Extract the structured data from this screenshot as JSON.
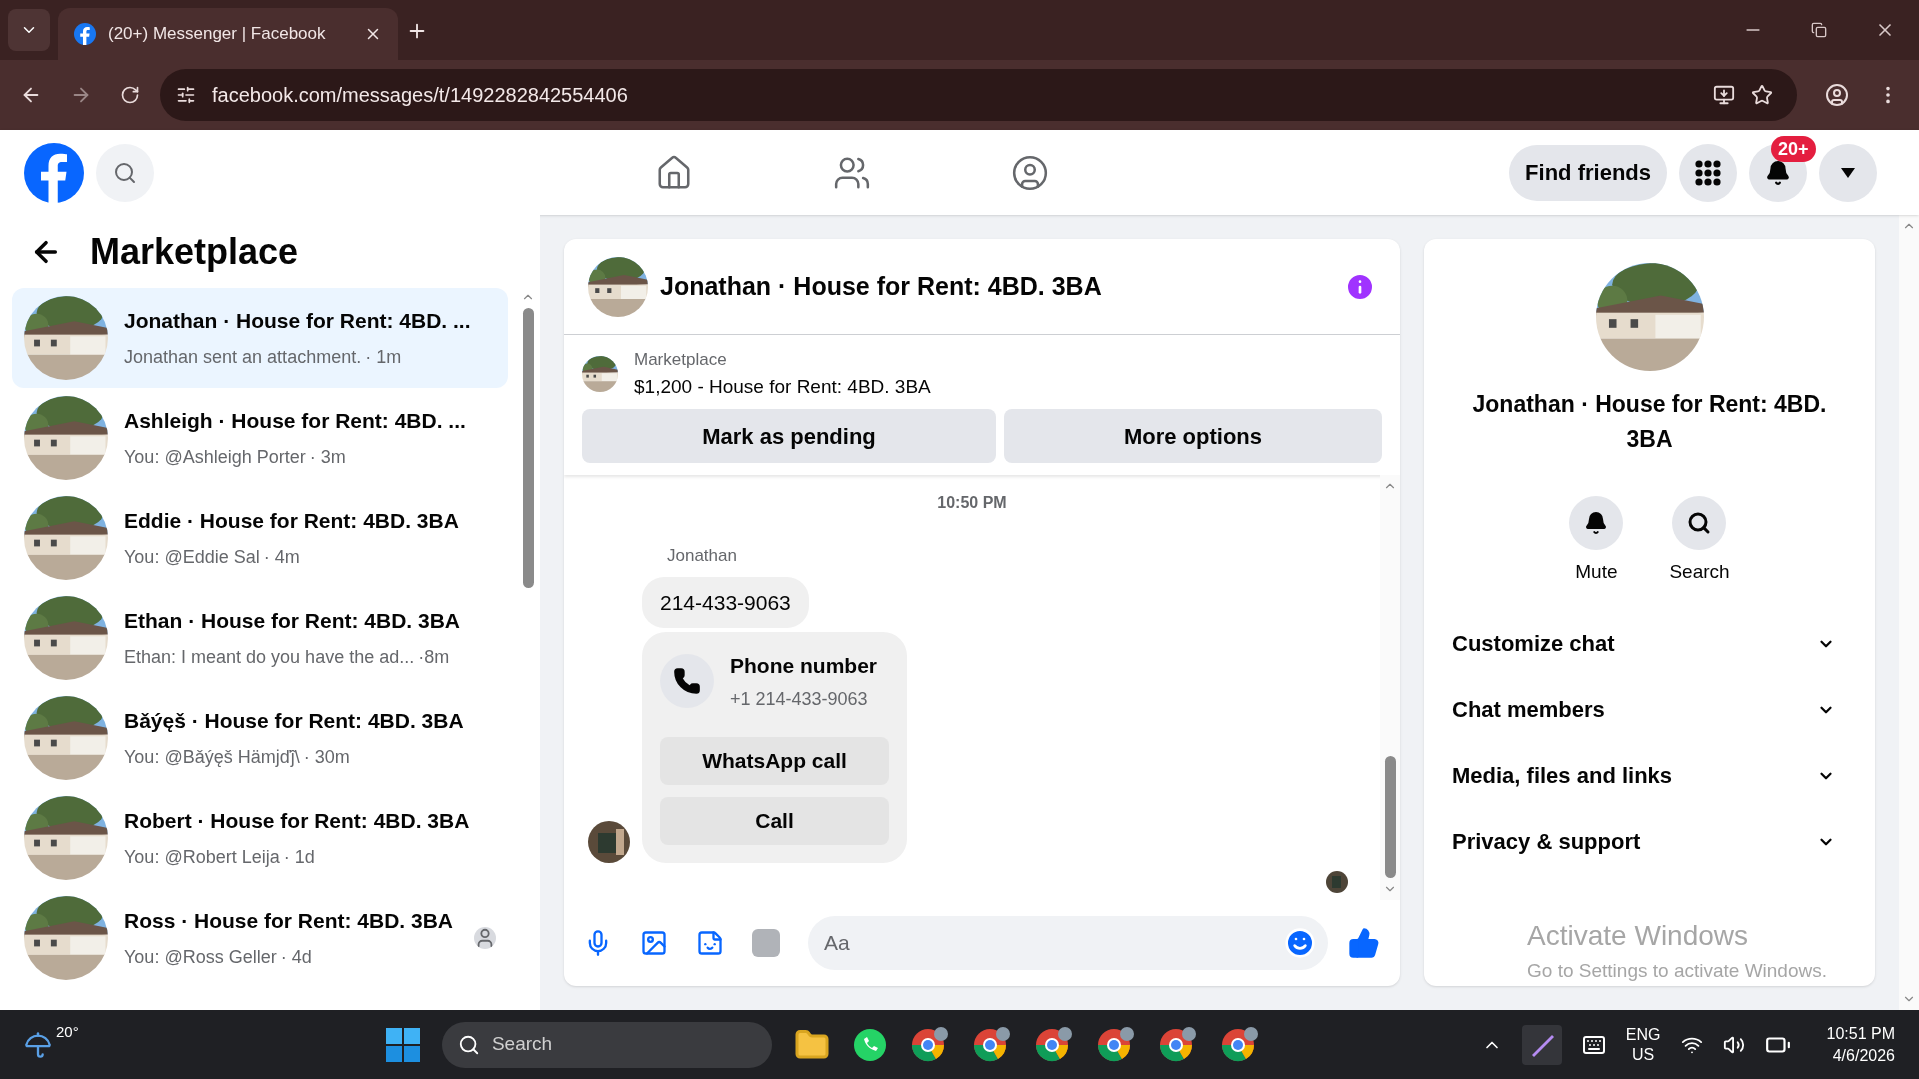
{
  "browser": {
    "tab_title": "(20+) Messenger | Facebook",
    "url": "facebook.com/messages/t/1492282842554406"
  },
  "header": {
    "find_friends": "Find friends",
    "notification_badge": "20+"
  },
  "sidebar": {
    "title": "Marketplace",
    "conversations": [
      {
        "title": "Jonathan · House for Rent: 4BD. ...",
        "preview": "Jonathan sent an attachment.",
        "time": "· 1m",
        "selected": true,
        "seen": false
      },
      {
        "title": "Ashleigh · House for Rent: 4BD. ...",
        "preview": "You: @Ashleigh Porter",
        "time": "· 3m",
        "selected": false,
        "seen": false
      },
      {
        "title": "Eddie · House for Rent: 4BD. 3BA",
        "preview": "You: @Eddie Sal",
        "time": "· 4m",
        "selected": false,
        "seen": false
      },
      {
        "title": "Ethan · House for Rent: 4BD. 3BA",
        "preview": "Ethan: I meant do you have the ad...",
        "time": "·8m",
        "selected": false,
        "seen": false
      },
      {
        "title": "Bǎýęš · House for Rent: 4BD. 3BA",
        "preview": "You: @Bǎýęš Hämјďĵ\\",
        "time": "· 30m",
        "selected": false,
        "seen": false
      },
      {
        "title": "Robert · House for Rent: 4BD. 3BA",
        "preview": "You: @Robert Leija",
        "time": "· 1d",
        "selected": false,
        "seen": false
      },
      {
        "title": "Ross · House for Rent: 4BD. 3BA",
        "preview": "You: @Ross Geller",
        "time": "· 4d",
        "selected": false,
        "seen": true
      }
    ]
  },
  "chat": {
    "title": "Jonathan · House for Rent: 4BD. 3BA",
    "listing": {
      "label": "Marketplace",
      "name": "$1,200 - House for Rent: 4BD. 3BA",
      "buttons": [
        "Mark as pending",
        "More options"
      ]
    },
    "timestamp": "10:50 PM",
    "sender": "Jonathan",
    "message": "214-433-9063",
    "phone_card": {
      "title": "Phone number",
      "number": "+1 214-433-9063",
      "buttons": [
        "WhatsApp call",
        "Call"
      ]
    },
    "composer": {
      "placeholder": "Aa"
    }
  },
  "details": {
    "title": "Jonathan · House for Rent: 4BD. 3BA",
    "actions": [
      "Mute",
      "Search"
    ],
    "sections": [
      {
        "label": "Customize chat",
        "expanded": false
      },
      {
        "label": "Chat members",
        "expanded": false
      },
      {
        "label": "Media, files and links",
        "expanded": false
      },
      {
        "label": "Privacy & support",
        "expanded": false
      }
    ]
  },
  "activation_notice": {
    "title": "Activate Windows",
    "text": "Go to Settings to activate Windows."
  },
  "taskbar": {
    "temperature": "20°",
    "search": "Search",
    "language": "ENG",
    "region": "US",
    "time": "10:51 PM",
    "date": "4/6/2026"
  }
}
